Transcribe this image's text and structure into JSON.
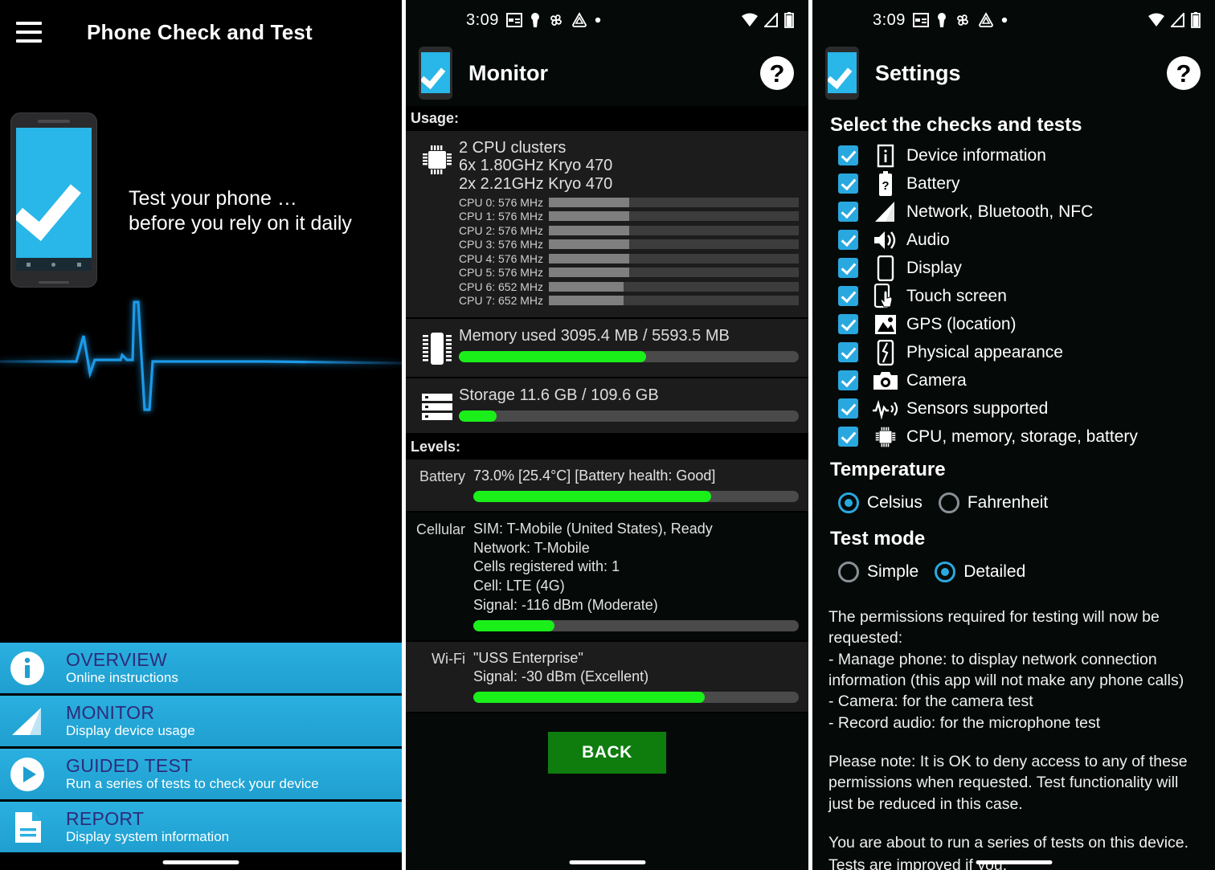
{
  "panel1": {
    "menu_icon": "hamburger-menu-icon",
    "title": "Phone Check and Test",
    "tagline_line1": "Test your phone …",
    "tagline_line2": "before you rely on it daily",
    "menu": [
      {
        "icon": "info-circle-icon",
        "title": "OVERVIEW",
        "subtitle": "Online instructions"
      },
      {
        "icon": "signal-bars-icon",
        "title": "MONITOR",
        "subtitle": "Display device usage"
      },
      {
        "icon": "play-circle-icon",
        "title": "GUIDED TEST",
        "subtitle": "Run a series of tests to check your device"
      },
      {
        "icon": "document-icon",
        "title": "REPORT",
        "subtitle": "Display system information"
      }
    ]
  },
  "statusbar": {
    "time": "3:09",
    "left_icons": [
      "calendar-icon",
      "key-icon",
      "pinwheel-icon",
      "triangle-drive-icon",
      "dot-icon"
    ],
    "right_icons": [
      "wifi-icon",
      "cellular-signal-icon",
      "battery-icon"
    ]
  },
  "panel2": {
    "app_icon": "app-phone-check-icon",
    "title": "Monitor",
    "help_label": "?",
    "usage_label": "Usage:",
    "cpu": {
      "icon": "cpu-chip-icon",
      "clusters": "2 CPU clusters",
      "cluster1": "6x 1.80GHz Kryo 470",
      "cluster2": "2x 2.21GHz Kryo 470",
      "cores": [
        {
          "label": "CPU 0: 576 MHz",
          "pct": 32
        },
        {
          "label": "CPU 1: 576 MHz",
          "pct": 32
        },
        {
          "label": "CPU 2: 576 MHz",
          "pct": 32
        },
        {
          "label": "CPU 3: 576 MHz",
          "pct": 32
        },
        {
          "label": "CPU 4: 576 MHz",
          "pct": 32
        },
        {
          "label": "CPU 5: 576 MHz",
          "pct": 32
        },
        {
          "label": "CPU 6: 652 MHz",
          "pct": 30
        },
        {
          "label": "CPU 7: 652 MHz",
          "pct": 30
        }
      ]
    },
    "memory": {
      "icon": "memory-chip-icon",
      "text": "Memory used 3095.4 MB / 5593.5 MB",
      "pct": 55
    },
    "storage": {
      "icon": "storage-drive-icon",
      "text": "Storage 11.6 GB / 109.6 GB",
      "pct": 11
    },
    "levels_label": "Levels:",
    "battery": {
      "label": "Battery",
      "text": "73.0% [25.4°C] [Battery health: Good]",
      "pct": 73
    },
    "cellular": {
      "label": "Cellular",
      "line1": "SIM: T-Mobile (United States), Ready",
      "line2": "Network: T-Mobile",
      "line3": "Cells registered with: 1",
      "line4": "Cell: LTE (4G)",
      "line5": "Signal: -116 dBm (Moderate)",
      "pct": 25
    },
    "wifi": {
      "label": "Wi-Fi",
      "line1": "\"USS Enterprise\"",
      "line2": "Signal: -30 dBm (Excellent)",
      "pct": 71
    },
    "back_label": "BACK"
  },
  "panel3": {
    "app_icon": "app-phone-check-icon",
    "title": "Settings",
    "help_label": "?",
    "checks_heading": "Select the checks and tests",
    "checks": [
      {
        "icon": "device-info-icon",
        "label": "Device information",
        "checked": true
      },
      {
        "icon": "battery-question-icon",
        "label": "Battery",
        "checked": true
      },
      {
        "icon": "signal-bars-icon",
        "label": "Network, Bluetooth, NFC",
        "checked": true
      },
      {
        "icon": "speaker-icon",
        "label": "Audio",
        "checked": true
      },
      {
        "icon": "display-icon",
        "label": "Display",
        "checked": true
      },
      {
        "icon": "touch-screen-icon",
        "label": "Touch screen",
        "checked": true
      },
      {
        "icon": "image-location-icon",
        "label": "GPS (location)",
        "checked": true
      },
      {
        "icon": "cracked-phone-icon",
        "label": "Physical appearance",
        "checked": true
      },
      {
        "icon": "camera-icon",
        "label": "Camera",
        "checked": true
      },
      {
        "icon": "sensor-wave-icon",
        "label": "Sensors supported",
        "checked": true
      },
      {
        "icon": "cpu-chip-icon",
        "label": "CPU, memory, storage, battery",
        "checked": true
      }
    ],
    "temperature_heading": "Temperature",
    "temperature_options": [
      {
        "label": "Celsius",
        "selected": true
      },
      {
        "label": "Fahrenheit",
        "selected": false
      }
    ],
    "testmode_heading": "Test mode",
    "testmode_options": [
      {
        "label": "Simple",
        "selected": false
      },
      {
        "label": "Detailed",
        "selected": true
      }
    ],
    "permissions_text": "The permissions required for testing will now be requested:\n- Manage phone: to display network connection information (this app will not make any phone calls)\n- Camera: for the camera test\n- Record audio: for the microphone test",
    "note_text": "Please note: It is OK to deny access to any of these permissions when requested. Test functionality will just be reduced in this case.",
    "about_text": "You are about to run a series of tests on this device.",
    "clipped_text": "Tests are improved if you:"
  },
  "colors": {
    "accent_blue": "#29b6e8",
    "menu_blue": "#2ab0e0",
    "menu_title_purple": "#2e2b7a",
    "bar_green": "#1aef1a",
    "back_green": "#0e7d0e"
  }
}
